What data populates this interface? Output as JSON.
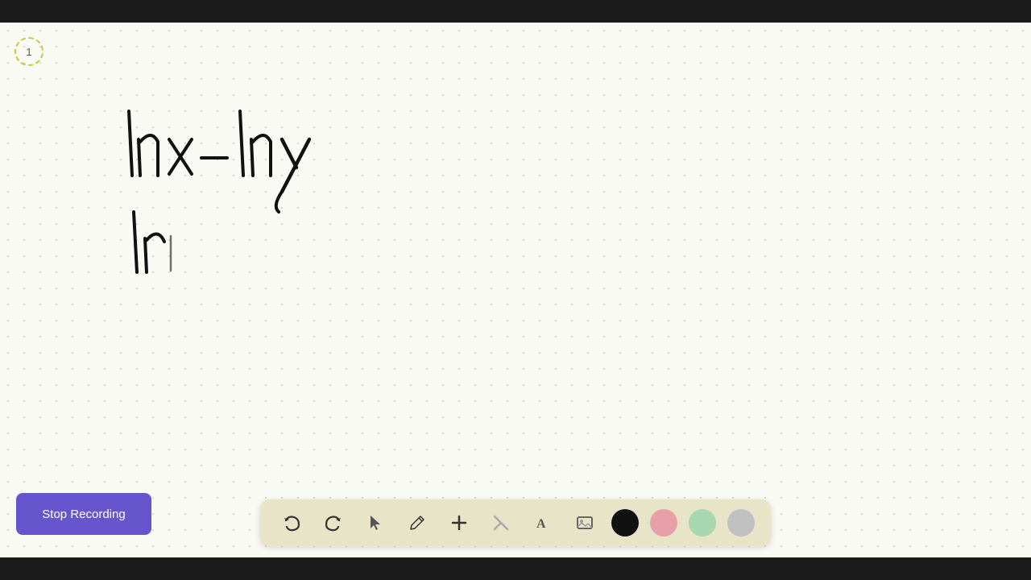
{
  "app": {
    "top_bar_color": "#1a1a1a",
    "bottom_bar_color": "#1a1a1a",
    "canvas_bg": "#fafaf5"
  },
  "page_indicator": {
    "number": "1"
  },
  "stop_recording_button": {
    "label": "Stop Recording",
    "bg_color": "#6655cc"
  },
  "toolbar": {
    "undo_label": "↺",
    "redo_label": "↻",
    "select_label": "▲",
    "pen_label": "✏",
    "add_label": "+",
    "eraser_label": "/",
    "text_label": "A",
    "image_label": "🖼",
    "colors": [
      "#111111",
      "#e8a0a8",
      "#a8d8b0",
      "#c0c0c0"
    ]
  }
}
